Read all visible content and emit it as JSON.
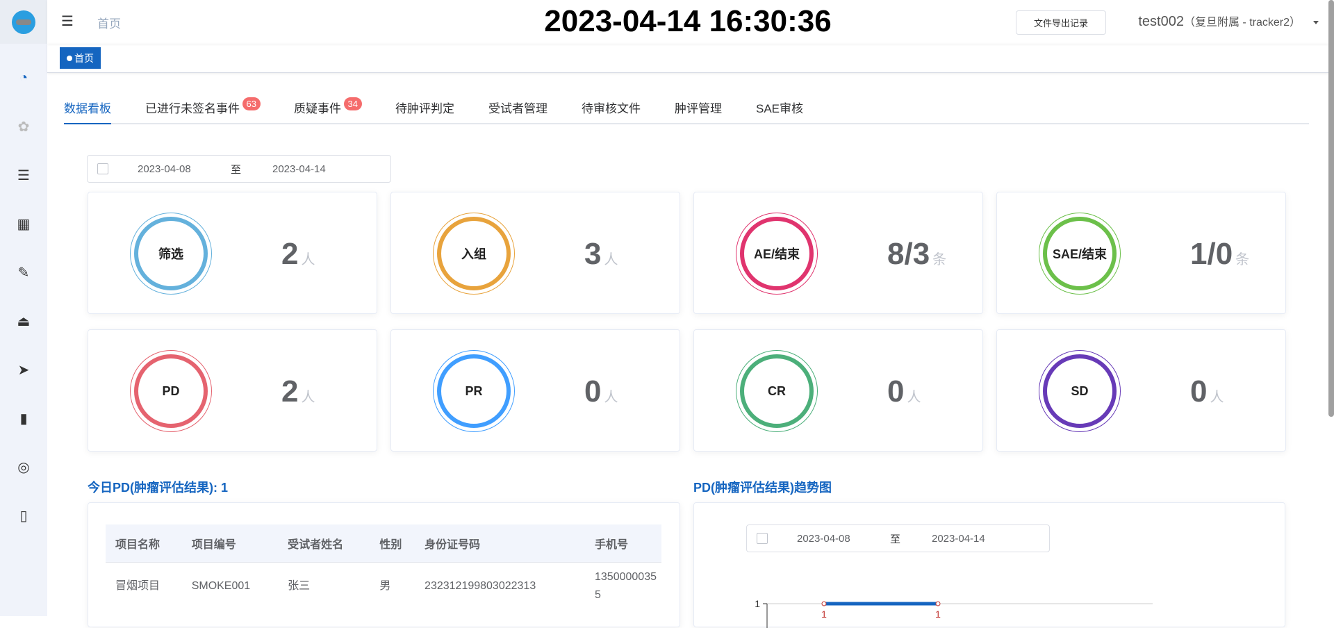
{
  "sidebar": {
    "items": [
      {
        "icon": "dashboard-icon"
      },
      {
        "icon": "gear-icon"
      },
      {
        "icon": "list-icon"
      },
      {
        "icon": "calendar-icon"
      },
      {
        "icon": "edit-document-icon"
      },
      {
        "icon": "lock-icon"
      },
      {
        "icon": "send-icon"
      },
      {
        "icon": "bar-chart-icon"
      },
      {
        "icon": "lifebuoy-icon"
      },
      {
        "icon": "book-icon"
      }
    ]
  },
  "header": {
    "breadcrumb": "首页",
    "datetime": "2023-04-14 16:30:36",
    "export_button": "文件导出记录",
    "user": "test002",
    "org": "（复旦附属 - tracker2）"
  },
  "tagbar": {
    "tag": "首页"
  },
  "tabs": [
    {
      "label": "数据看板"
    },
    {
      "label": "已进行未签名事件",
      "badge": "63"
    },
    {
      "label": "质疑事件",
      "badge": "34"
    },
    {
      "label": "待肿评判定"
    },
    {
      "label": "受试者管理"
    },
    {
      "label": "待审核文件"
    },
    {
      "label": "肿评管理"
    },
    {
      "label": "SAE审核"
    }
  ],
  "date_range": {
    "start": "2023-04-08",
    "sep": "至",
    "end": "2023-04-14"
  },
  "stats": [
    {
      "label": "筛选",
      "value": "2",
      "unit": "人",
      "color": "#64b1dc"
    },
    {
      "label": "入组",
      "value": "3",
      "unit": "人",
      "color": "#e8a33c"
    },
    {
      "label": "AE/结束",
      "value": "8/3",
      "unit": "条",
      "color": "#e0346e"
    },
    {
      "label": "SAE/结束",
      "value": "1/0",
      "unit": "条",
      "color": "#6cc04a"
    },
    {
      "label": "PD",
      "value": "2",
      "unit": "人",
      "color": "#e5636f"
    },
    {
      "label": "PR",
      "value": "0",
      "unit": "人",
      "color": "#409eff"
    },
    {
      "label": "CR",
      "value": "0",
      "unit": "人",
      "color": "#4caf7a"
    },
    {
      "label": "SD",
      "value": "0",
      "unit": "人",
      "color": "#673ab7"
    }
  ],
  "today_pd": {
    "title": "今日PD(肿瘤评估结果): 1",
    "columns": [
      "项目名称",
      "项目编号",
      "受试者姓名",
      "性别",
      "身份证号码",
      "手机号"
    ],
    "rows": [
      [
        "冒烟项目",
        "SMOKE001",
        "张三",
        "男",
        "232312199803022313",
        "13500000355"
      ]
    ]
  },
  "trend": {
    "title": "PD(肿瘤评估结果)趋势图",
    "date_range": {
      "start": "2023-04-08",
      "sep": "至",
      "end": "2023-04-14"
    }
  },
  "chart_data": {
    "type": "line",
    "y_ticks": [
      "1"
    ],
    "series": [
      {
        "values": [
          1,
          1
        ],
        "color": "#1565c0",
        "point_label_color": "#c23531"
      }
    ],
    "point_labels": [
      "1",
      "1"
    ]
  }
}
